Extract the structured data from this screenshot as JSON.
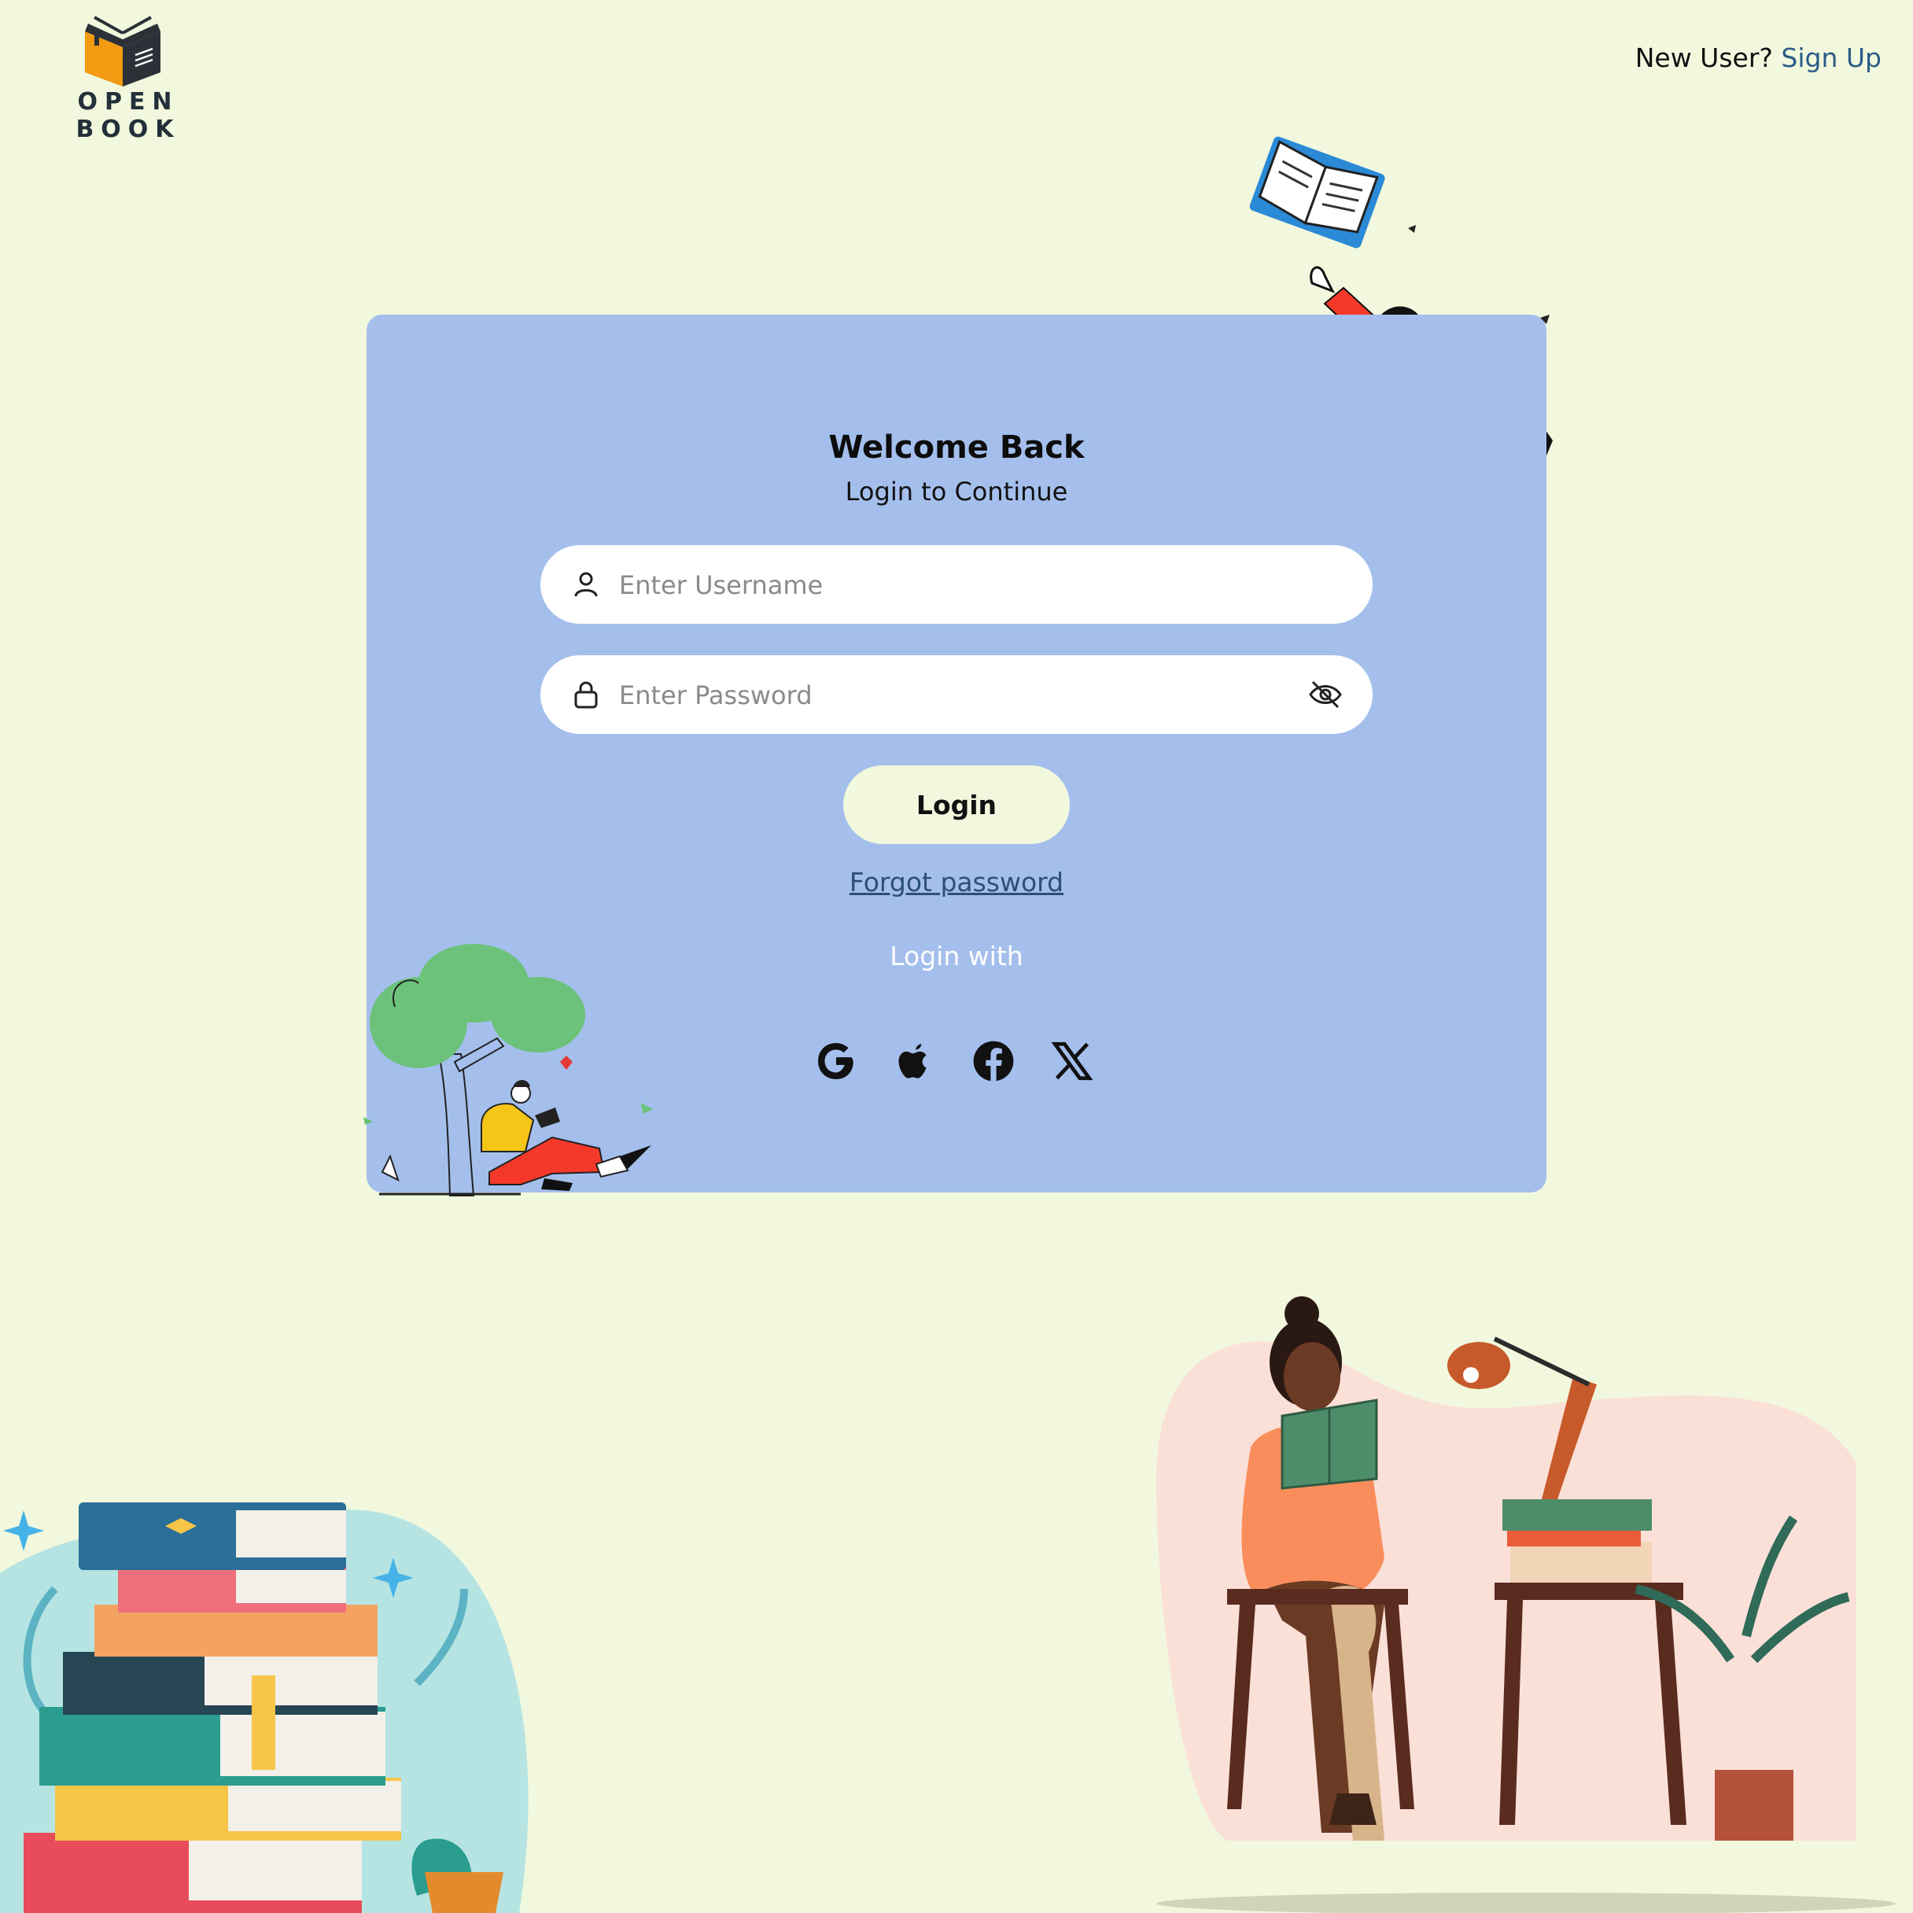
{
  "brand": {
    "name": "OPEN BOOK",
    "logo_icon": "open-book-logo"
  },
  "header": {
    "new_user_text": "New User?",
    "signup_label": "Sign Up"
  },
  "login_card": {
    "title": "Welcome Back",
    "subtitle": "Login to Continue",
    "username": {
      "placeholder": "Enter Username",
      "value": "",
      "icon": "user-icon"
    },
    "password": {
      "placeholder": "Enter Password",
      "value": "",
      "icon": "lock-icon",
      "toggle_icon": "eye-off-icon"
    },
    "login_label": "Login",
    "forgot_label": "Forgot password",
    "login_with_label": "Login with",
    "social": [
      "google-icon",
      "apple-icon",
      "facebook-icon",
      "x-icon"
    ]
  },
  "colors": {
    "page_background": "#f1f8dd",
    "card_background": "#a4bfec",
    "link": "#2b5c87",
    "button": "#f1f8dd"
  }
}
